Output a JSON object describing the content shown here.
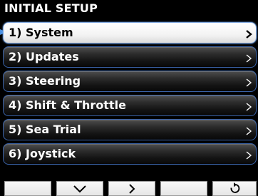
{
  "header": {
    "title": "INITIAL SETUP"
  },
  "menu": {
    "items": [
      {
        "label": "1) System",
        "selected": true
      },
      {
        "label": "2) Updates",
        "selected": false
      },
      {
        "label": "3) Steering",
        "selected": false
      },
      {
        "label": "4) Shift & Throttle",
        "selected": false
      },
      {
        "label": "5) Sea Trial",
        "selected": false
      },
      {
        "label": "6) Joystick",
        "selected": false
      }
    ]
  },
  "softkeys": [
    {
      "icon": "blank"
    },
    {
      "icon": "chevron-down-icon"
    },
    {
      "icon": "chevron-right-icon"
    },
    {
      "icon": "blank"
    },
    {
      "icon": "return-arrow-icon"
    }
  ],
  "colors": {
    "background": "#000000",
    "item_border": "#3a63a8",
    "selected_bg": "#ffffff",
    "pointer": "#4a90e2"
  }
}
